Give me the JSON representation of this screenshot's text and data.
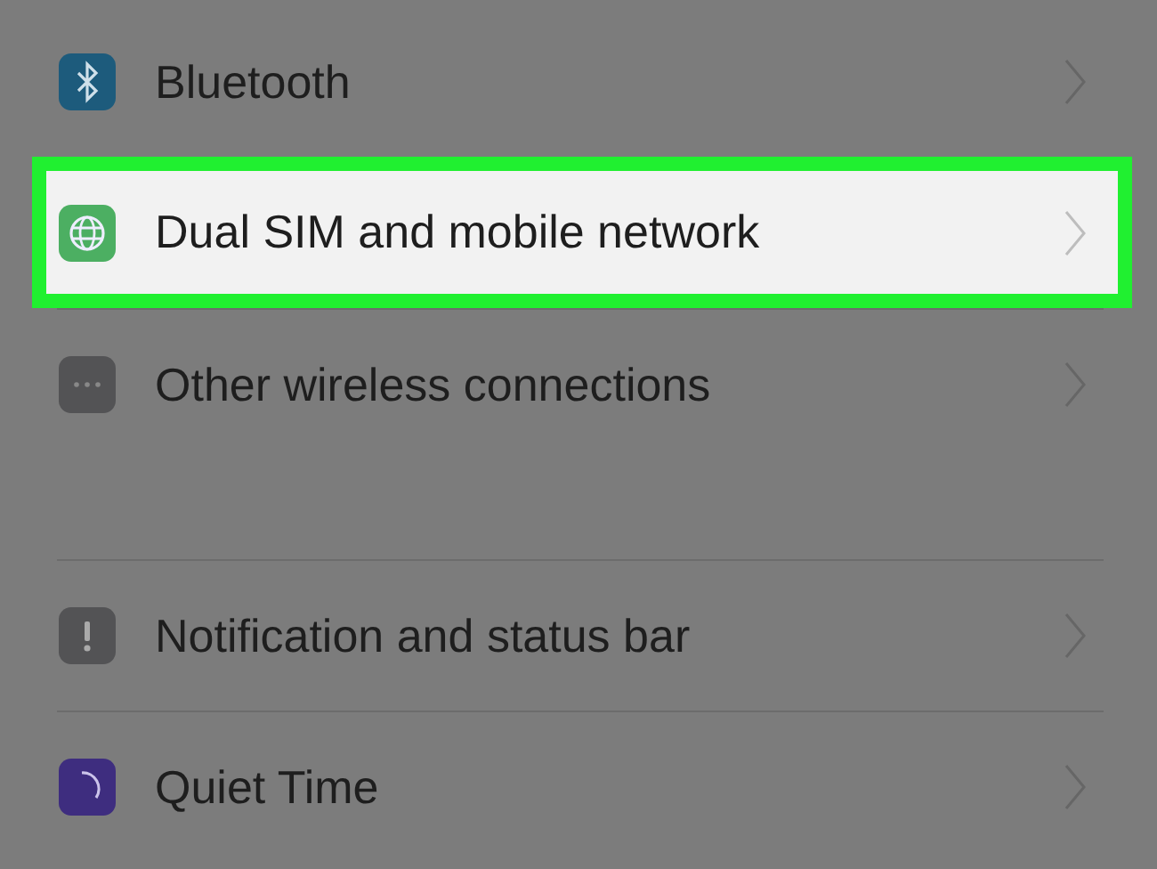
{
  "groups": [
    {
      "items": [
        {
          "label": "Bluetooth",
          "kind": "bluetooth",
          "color": "#1d5b7c",
          "highlighted": false
        },
        {
          "label": "Dual SIM and mobile network",
          "kind": "globe",
          "color": "#4caf62",
          "highlighted": true
        },
        {
          "label": "Other wireless connections",
          "kind": "dots",
          "color": "#535355",
          "highlighted": false
        }
      ]
    },
    {
      "items": [
        {
          "label": "Notification and status bar",
          "kind": "alert",
          "color": "#535355",
          "highlighted": false
        },
        {
          "label": "Quiet Time",
          "kind": "moon",
          "color": "#3e2d7f",
          "highlighted": false
        }
      ]
    }
  ]
}
